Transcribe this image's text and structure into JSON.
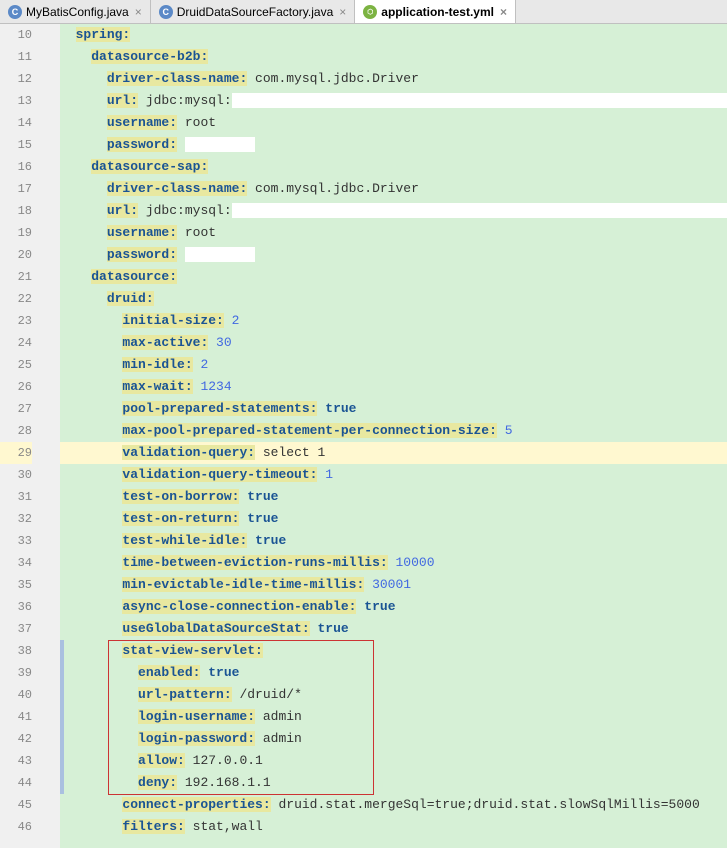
{
  "tabs": [
    {
      "label": "MyBatisConfig.java",
      "icon": "C"
    },
    {
      "label": "DruidDataSourceFactory.java",
      "icon": "C"
    },
    {
      "label": "application-test.yml",
      "icon": "yml"
    }
  ],
  "lines": {
    "10": {
      "num": "10",
      "indent": 1,
      "key": "spring",
      "colon": ":"
    },
    "11": {
      "num": "11",
      "indent": 2,
      "key": "datasource-b2b",
      "colon": ":"
    },
    "12": {
      "num": "12",
      "indent": 3,
      "key": "driver-class-name",
      "colon": ":",
      "val": " com.mysql.jdbc.Driver"
    },
    "13": {
      "num": "13",
      "indent": 3,
      "key": "url",
      "colon": ":",
      "val": " jdbc:mysql:"
    },
    "14": {
      "num": "14",
      "indent": 3,
      "key": "username",
      "colon": ":",
      "val": " root"
    },
    "15": {
      "num": "15",
      "indent": 3,
      "key": "password",
      "colon": ":",
      "val": " "
    },
    "16": {
      "num": "16",
      "indent": 2,
      "key": "datasource-sap",
      "colon": ":"
    },
    "17": {
      "num": "17",
      "indent": 3,
      "key": "driver-class-name",
      "colon": ":",
      "val": " com.mysql.jdbc.Driver"
    },
    "18": {
      "num": "18",
      "indent": 3,
      "key": "url",
      "colon": ":",
      "val": " jdbc:mysql:"
    },
    "19": {
      "num": "19",
      "indent": 3,
      "key": "username",
      "colon": ":",
      "val": " root"
    },
    "20": {
      "num": "20",
      "indent": 3,
      "key": "password",
      "colon": ":",
      "val": " "
    },
    "21": {
      "num": "21",
      "indent": 2,
      "key": "datasource",
      "colon": ":"
    },
    "22": {
      "num": "22",
      "indent": 3,
      "key": "druid",
      "colon": ":"
    },
    "23": {
      "num": "23",
      "indent": 4,
      "key": "initial-size",
      "colon": ":",
      "num_val": " 2"
    },
    "24": {
      "num": "24",
      "indent": 4,
      "key": "max-active",
      "colon": ":",
      "num_val": " 30"
    },
    "25": {
      "num": "25",
      "indent": 4,
      "key": "min-idle",
      "colon": ":",
      "num_val": " 2"
    },
    "26": {
      "num": "26",
      "indent": 4,
      "key": "max-wait",
      "colon": ":",
      "num_val": " 1234"
    },
    "27": {
      "num": "27",
      "indent": 4,
      "key": "pool-prepared-statements",
      "colon": ":",
      "bool_val": " true"
    },
    "28": {
      "num": "28",
      "indent": 4,
      "key": "max-pool-prepared-statement-per-connection-size",
      "colon": ":",
      "num_val": " 5"
    },
    "29": {
      "num": "29",
      "indent": 4,
      "key": "validation-query",
      "colon": ":",
      "val": " select 1"
    },
    "30": {
      "num": "30",
      "indent": 4,
      "key": "validation-query-timeout",
      "colon": ":",
      "num_val": " 1"
    },
    "31": {
      "num": "31",
      "indent": 4,
      "key": "test-on-borrow",
      "colon": ":",
      "bool_val": " true"
    },
    "32": {
      "num": "32",
      "indent": 4,
      "key": "test-on-return",
      "colon": ":",
      "bool_val": " true"
    },
    "33": {
      "num": "33",
      "indent": 4,
      "key": "test-while-idle",
      "colon": ":",
      "bool_val": " true"
    },
    "34": {
      "num": "34",
      "indent": 4,
      "key": "time-between-eviction-runs-millis",
      "colon": ":",
      "num_val": " 10000"
    },
    "35": {
      "num": "35",
      "indent": 4,
      "key": "min-evictable-idle-time-millis",
      "colon": ":",
      "num_val": " 30001"
    },
    "36": {
      "num": "36",
      "indent": 4,
      "key": "async-close-connection-enable",
      "colon": ":",
      "bool_val": " true"
    },
    "37": {
      "num": "37",
      "indent": 4,
      "key": "useGlobalDataSourceStat",
      "colon": ":",
      "bool_val": " true"
    },
    "38": {
      "num": "38",
      "indent": 4,
      "key": "stat-view-servlet",
      "colon": ":"
    },
    "39": {
      "num": "39",
      "indent": 5,
      "key": "enabled",
      "colon": ":",
      "bool_val": " true"
    },
    "40": {
      "num": "40",
      "indent": 5,
      "key": "url-pattern",
      "colon": ":",
      "val": " /druid/*"
    },
    "41": {
      "num": "41",
      "indent": 5,
      "key": "login-username",
      "colon": ":",
      "val": " admin"
    },
    "42": {
      "num": "42",
      "indent": 5,
      "key": "login-password",
      "colon": ":",
      "val": " admin"
    },
    "43": {
      "num": "43",
      "indent": 5,
      "key": "allow",
      "colon": ":",
      "val": " 127.0.0.1"
    },
    "44": {
      "num": "44",
      "indent": 5,
      "key": "deny",
      "colon": ":",
      "val": " 192.168.1.1"
    },
    "45": {
      "num": "45",
      "indent": 4,
      "key": "connect-properties",
      "colon": ":",
      "val": " druid.stat.mergeSql=true;druid.stat.slowSqlMillis=5000"
    },
    "46": {
      "num": "46",
      "indent": 4,
      "key": "filters",
      "colon": ":",
      "val": " stat,wall"
    }
  }
}
